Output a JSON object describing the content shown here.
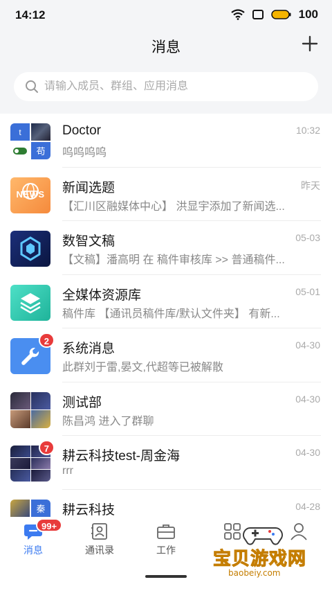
{
  "status_bar": {
    "time": "14:12",
    "battery": "100"
  },
  "header": {
    "title": "消息"
  },
  "search": {
    "placeholder": "请输入成员、群组、应用消息"
  },
  "conversations": [
    {
      "name": "Doctor",
      "preview": "呜呜呜呜",
      "time": "10:32",
      "badge": "",
      "avatar_tiles": [
        "t",
        "",
        "",
        "苟"
      ]
    },
    {
      "name": "新闻选题",
      "preview": "【汇川区融媒体中心】 洪显宇添加了新闻选...",
      "time": "昨天",
      "badge": "",
      "avatar_text": "NEWS"
    },
    {
      "name": "数智文稿",
      "preview": "【文稿】潘高明 在 稿件审核库 >> 普通稿件...",
      "time": "05-03",
      "badge": ""
    },
    {
      "name": "全媒体资源库",
      "preview": "稿件库 【通讯员稿件库/默认文件夹】 有新...",
      "time": "05-01",
      "badge": ""
    },
    {
      "name": "系统消息",
      "preview": "此群刘于雷,晏文,代超等已被解散",
      "time": "04-30",
      "badge": "2"
    },
    {
      "name": "测试部",
      "preview": "陈昌鸿 进入了群聊",
      "time": "04-30",
      "badge": ""
    },
    {
      "name": "耕云科技test-周金海",
      "preview": "rrr",
      "time": "04-30",
      "badge": "7"
    },
    {
      "name": "耕云科技",
      "preview": "",
      "time": "04-28",
      "badge": "",
      "avatar_tiles": [
        "",
        "秦"
      ]
    }
  ],
  "tabs": [
    {
      "label": "消息",
      "badge": "99+"
    },
    {
      "label": "通讯录"
    },
    {
      "label": "工作"
    },
    {
      "label": ""
    },
    {
      "label": ""
    }
  ],
  "watermark": {
    "text": "宝贝游戏网",
    "url": "baobeiy.com"
  },
  "colors": {
    "accent": "#3c7bf0",
    "badge": "#e83b3b",
    "background": "#f4f5f7"
  }
}
